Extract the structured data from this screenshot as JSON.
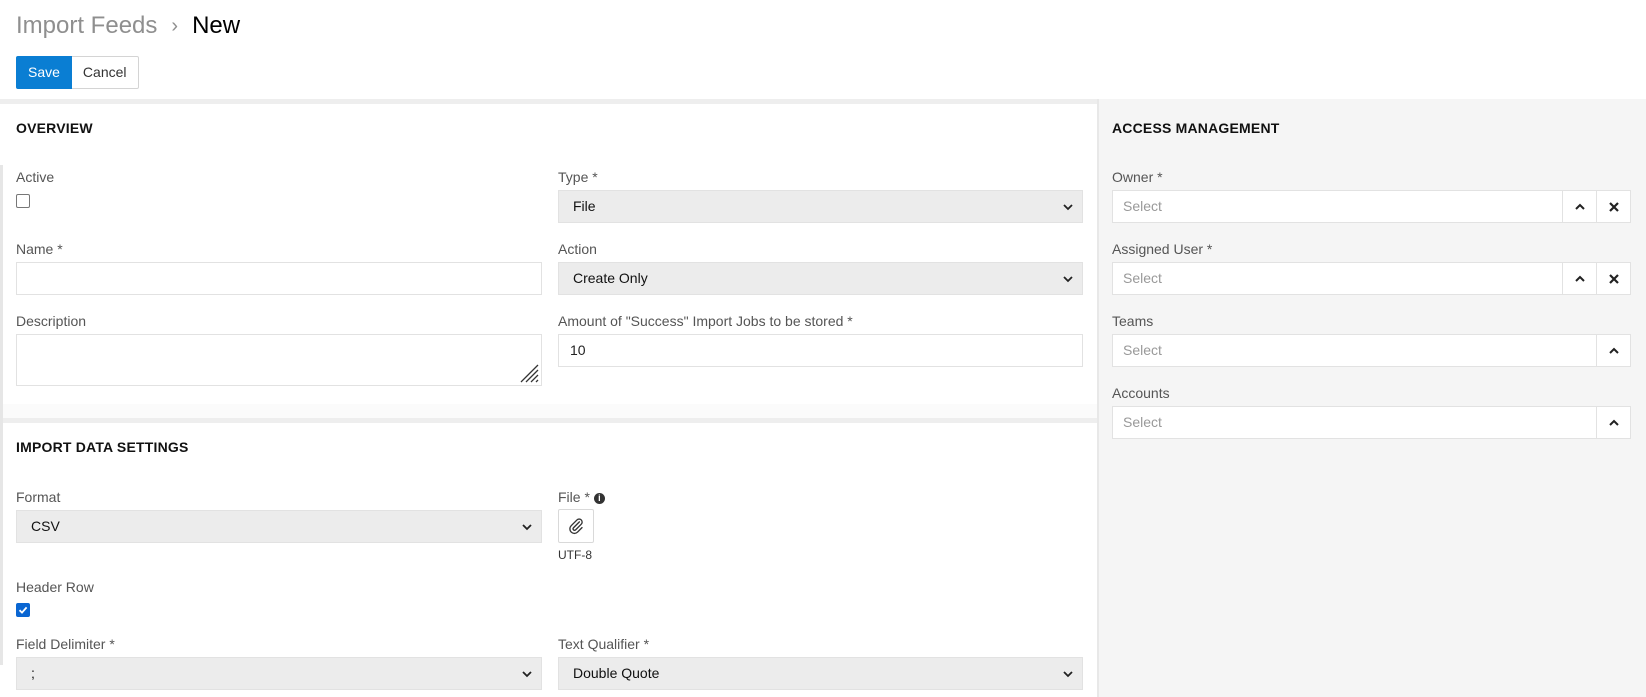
{
  "breadcrumb": {
    "parent": "Import Feeds",
    "separator": "›",
    "current": "New"
  },
  "toolbar": {
    "save_label": "Save",
    "cancel_label": "Cancel"
  },
  "overview": {
    "title": "OVERVIEW",
    "active": {
      "label": "Active",
      "checked": false
    },
    "type": {
      "label": "Type *",
      "value": "File"
    },
    "name": {
      "label": "Name *",
      "value": ""
    },
    "action": {
      "label": "Action",
      "value": "Create Only"
    },
    "description": {
      "label": "Description",
      "value": ""
    },
    "jobs_stored": {
      "label": "Amount of \"Success\" Import Jobs to be stored *",
      "value": "10"
    }
  },
  "import_settings": {
    "title": "IMPORT DATA SETTINGS",
    "format": {
      "label": "Format",
      "value": "CSV"
    },
    "file": {
      "label": "File *",
      "encoding": "UTF-8"
    },
    "header_row": {
      "label": "Header Row",
      "checked": true
    },
    "field_delimiter": {
      "label": "Field Delimiter *",
      "value": ";"
    },
    "text_qualifier": {
      "label": "Text Qualifier *",
      "value": "Double Quote"
    }
  },
  "access": {
    "title": "ACCESS MANAGEMENT",
    "owner": {
      "label": "Owner *",
      "placeholder": "Select"
    },
    "assigned_user": {
      "label": "Assigned User *",
      "placeholder": "Select"
    },
    "teams": {
      "label": "Teams",
      "placeholder": "Select"
    },
    "accounts": {
      "label": "Accounts",
      "placeholder": "Select"
    }
  },
  "icons": {
    "chevron": "chevron-down-icon",
    "expand": "chevron-up-icon",
    "clear": "close-icon",
    "attach": "paperclip-icon",
    "info": "info-icon"
  },
  "colors": {
    "primary": "#0a7ed3",
    "checkbox": "#0a66d2"
  }
}
